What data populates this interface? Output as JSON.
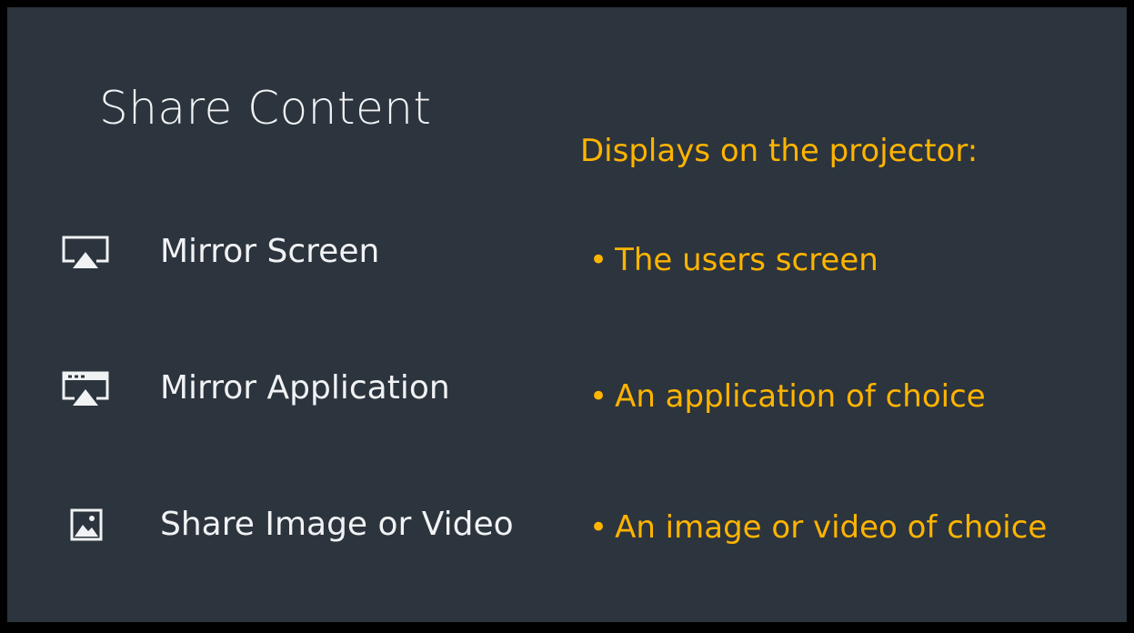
{
  "colors": {
    "background": "#2c343d",
    "frame": "#000000",
    "text": "#f0f2f4",
    "accent": "#ffb400"
  },
  "title": "Share Content",
  "subhead": "Displays on the projector:",
  "options": [
    {
      "label": "Mirror Screen",
      "icon": "airplay-screen-icon"
    },
    {
      "label": "Mirror Application",
      "icon": "airplay-window-icon"
    },
    {
      "label": "Share Image or Video",
      "icon": "image-icon"
    }
  ],
  "bullet_marker": "•",
  "bullets": [
    "The users screen",
    "An application of choice",
    "An image or video of choice"
  ]
}
